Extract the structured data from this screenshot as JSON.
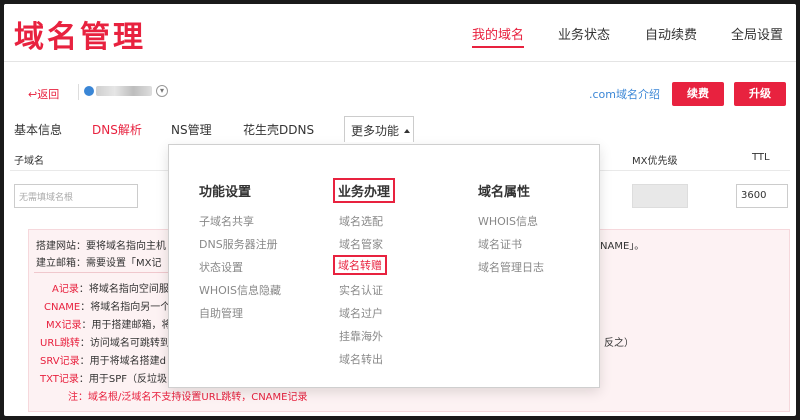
{
  "header": {
    "title": "域名管理",
    "nav": [
      "我的域名",
      "业务状态",
      "自动续费",
      "全局设置"
    ]
  },
  "domain_bar": {
    "back_label": "↩返回",
    "intro_link": ".com域名介绍",
    "renew_label": "续费",
    "upgrade_label": "升级"
  },
  "tabs": {
    "basic": "基本信息",
    "dns": "DNS解析",
    "ns": "NS管理",
    "ddns": "花生壳DDNS",
    "more": "更多功能"
  },
  "table": {
    "col_subdomain": "子域名",
    "col_mx": "MX优先级",
    "col_ttl": "TTL",
    "subdomain_placeholder": "无需填域名根",
    "ttl_value": "3600"
  },
  "help": {
    "site_line": "搭建网站：要将域名指向主机",
    "mail_line_a": "建立邮箱：需要设置「MX记",
    "mail_line_b": "NAME」。",
    "records": [
      {
        "key": "A记录",
        "text": "：将域名指向空间服"
      },
      {
        "key": "CNAME",
        "text": "：将域名指向另一个"
      },
      {
        "key": "MX记录",
        "text": "：用于搭建邮箱，将"
      },
      {
        "key": "URL跳转",
        "text": "：访问域名可跳转到"
      },
      {
        "key": "SRV记录",
        "text": "：用于将域名搭建d"
      },
      {
        "key": "TXT记录",
        "text": "：用于SPF（反垃圾"
      }
    ],
    "trailing": "反之）",
    "note_key": "注",
    "note_text": "：域名根/泛域名不支持设置URL跳转，CNAME记录"
  },
  "dropdown": {
    "columns": [
      {
        "title": "功能设置",
        "items": [
          "子域名共享",
          "DNS服务器注册",
          "状态设置",
          "WHOIS信息隐藏",
          "自助管理"
        ]
      },
      {
        "title": "业务办理",
        "items": [
          "域名选配",
          "域名管家",
          "域名转赠",
          "实名认证",
          "域名过户",
          "挂靠海外",
          "域名转出"
        ]
      },
      {
        "title": "域名属性",
        "items": [
          "WHOIS信息",
          "域名证书",
          "域名管理日志"
        ]
      }
    ]
  },
  "colors": {
    "accent": "#e8223f",
    "link": "#3a86d6"
  }
}
